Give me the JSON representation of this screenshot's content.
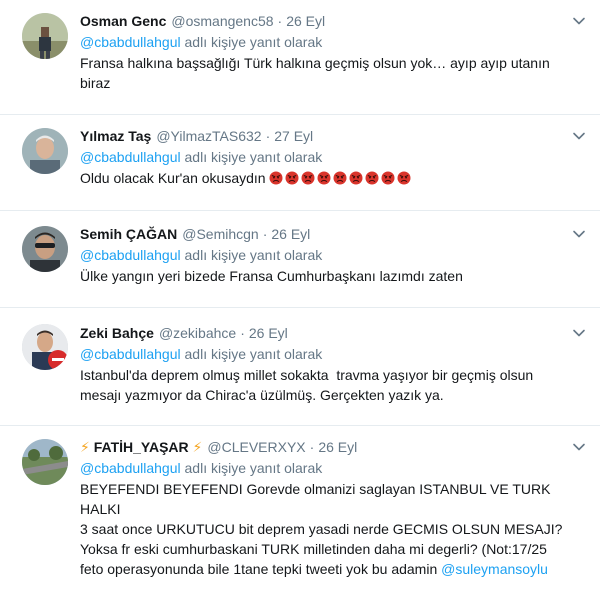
{
  "tweets": [
    {
      "name": "Osman Genc",
      "handle": "@osmangenc58",
      "sep": "·",
      "date": "26 Eyl",
      "reply_mention": "@cbabdullahgul",
      "reply_suffix": " adlı kişiye yanıt olarak",
      "text": "Fransa halkına başsağlığı Türk halkına geçmiş olsun yok… ayıp ayıp utanın\nbiraz"
    },
    {
      "name": "Yılmaz Taş",
      "handle": "@YilmazTAS632",
      "sep": "·",
      "date": "27 Eyl",
      "reply_mention": "@cbabdullahgul",
      "reply_suffix": " adlı kişiye yanıt olarak",
      "text": "Oldu olacak Kur'an okusaydın ",
      "emoji": "angry-face-icon",
      "emoji_count": 9
    },
    {
      "name": "Semih ÇAĞAN",
      "handle": "@Semihcgn",
      "sep": "·",
      "date": "26 Eyl",
      "reply_mention": "@cbabdullahgul",
      "reply_suffix": " adlı kişiye yanıt olarak",
      "text": "Ülke yangın yeri bizede Fransa Cumhurbaşkanı lazımdı zaten"
    },
    {
      "name": "Zeki Bahçe",
      "handle": "@zekibahce",
      "sep": "·",
      "date": "26 Eyl",
      "reply_mention": "@cbabdullahgul",
      "reply_suffix": " adlı kişiye yanıt olarak",
      "text": "Istanbul'da deprem olmuş millet sokakta  travma yaşıyor bir geçmiş olsun\nmesajı yazmıyor da Chirac'a üzülmüş. Gerçekten yazık ya."
    },
    {
      "name": "FATİH_YAŞAR",
      "name_icon": "⚡",
      "handle": "@CLEVERXYX",
      "sep": "·",
      "date": "26 Eyl",
      "reply_mention": "@cbabdullahgul",
      "reply_suffix": " adlı kişiye yanıt olarak",
      "text": "BEYEFENDI BEYEFENDI Gorevde olmanizi saglayan ISTANBUL VE TURK HALKI\n3 saat once URKUTUCU bit deprem yasadi nerde GECMIS OLSUN MESAJI?\nYoksa fr eski cumhurbaskani TURK milletinden daha mi degerli? (Not:17/25\nfeto operasyonunda bile 1tane tepki tweeti yok bu adamin ",
      "text_mention": "@suleymansoylu"
    }
  ],
  "colors": {
    "link": "#1da1f2",
    "muted": "#657786",
    "text": "#14171a",
    "angry": "#d9342b"
  }
}
